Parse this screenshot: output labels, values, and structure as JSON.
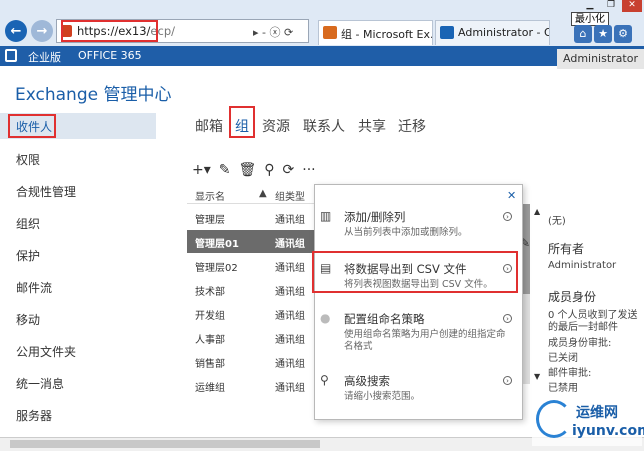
{
  "browser": {
    "url_main": "https://ex13/",
    "url_path": "ecp/",
    "tabs": [
      {
        "label": "组 - Microsoft Ex..."
      },
      {
        "label": "Administrator - Ou..."
      }
    ],
    "tooltip": "最小化",
    "addr_icons": "▸ - ⓧ ⟳"
  },
  "o365": {
    "edition": "企业版",
    "brand": "OFFICE 365",
    "user": "Administrator"
  },
  "app": {
    "title": "Exchange 管理中心"
  },
  "sidebar": {
    "items": [
      "收件人",
      "权限",
      "合规性管理",
      "组织",
      "保护",
      "邮件流",
      "移动",
      "公用文件夹",
      "统一消息",
      "服务器"
    ]
  },
  "top_tabs": [
    "邮箱",
    "组",
    "资源",
    "联系人",
    "共享",
    "迁移"
  ],
  "toolbar": {
    "add": "+▾",
    "edit": "✎",
    "delete": "🗑",
    "search": "⚲",
    "refresh": "⟳",
    "more": "···"
  },
  "list": {
    "headers": [
      "显示名",
      "组类型"
    ],
    "rows": [
      {
        "name": "管理层",
        "type": "通讯组"
      },
      {
        "name": "管理层01",
        "type": "通讯组",
        "selected": true
      },
      {
        "name": "管理层02",
        "type": "通讯组"
      },
      {
        "name": "技术部",
        "type": "通讯组"
      },
      {
        "name": "开发组",
        "type": "通讯组"
      },
      {
        "name": "人事部",
        "type": "通讯组"
      },
      {
        "name": "销售部",
        "type": "通讯组"
      },
      {
        "name": "运维组",
        "type": "通讯组"
      }
    ]
  },
  "menu": {
    "items": [
      {
        "title": "添加/删除列",
        "desc": "从当前列表中添加或删除列。"
      },
      {
        "title": "将数据导出到 CSV 文件",
        "desc": "将列表视图数据导出到 CSV 文件。"
      },
      {
        "title": "配置组命名策略",
        "desc": "使用组命名策略为用户创建的组指定命名格式"
      },
      {
        "title": "高级搜索",
        "desc": "请缩小搜索范围。"
      }
    ]
  },
  "detail": {
    "none": "(无)",
    "owner_heading": "所有者",
    "owner": "Administrator",
    "membership_heading": "成员身份",
    "membership_desc1": "0 个人员收到了发送",
    "membership_desc2": "的最后一封邮件",
    "approval_label": "成员身份审批:",
    "approval_value": "已关闭",
    "moderation_label": "邮件审批:",
    "moderation_value": "已禁用"
  },
  "watermark": {
    "line1": "运维网",
    "line2": "iyunv.com"
  }
}
